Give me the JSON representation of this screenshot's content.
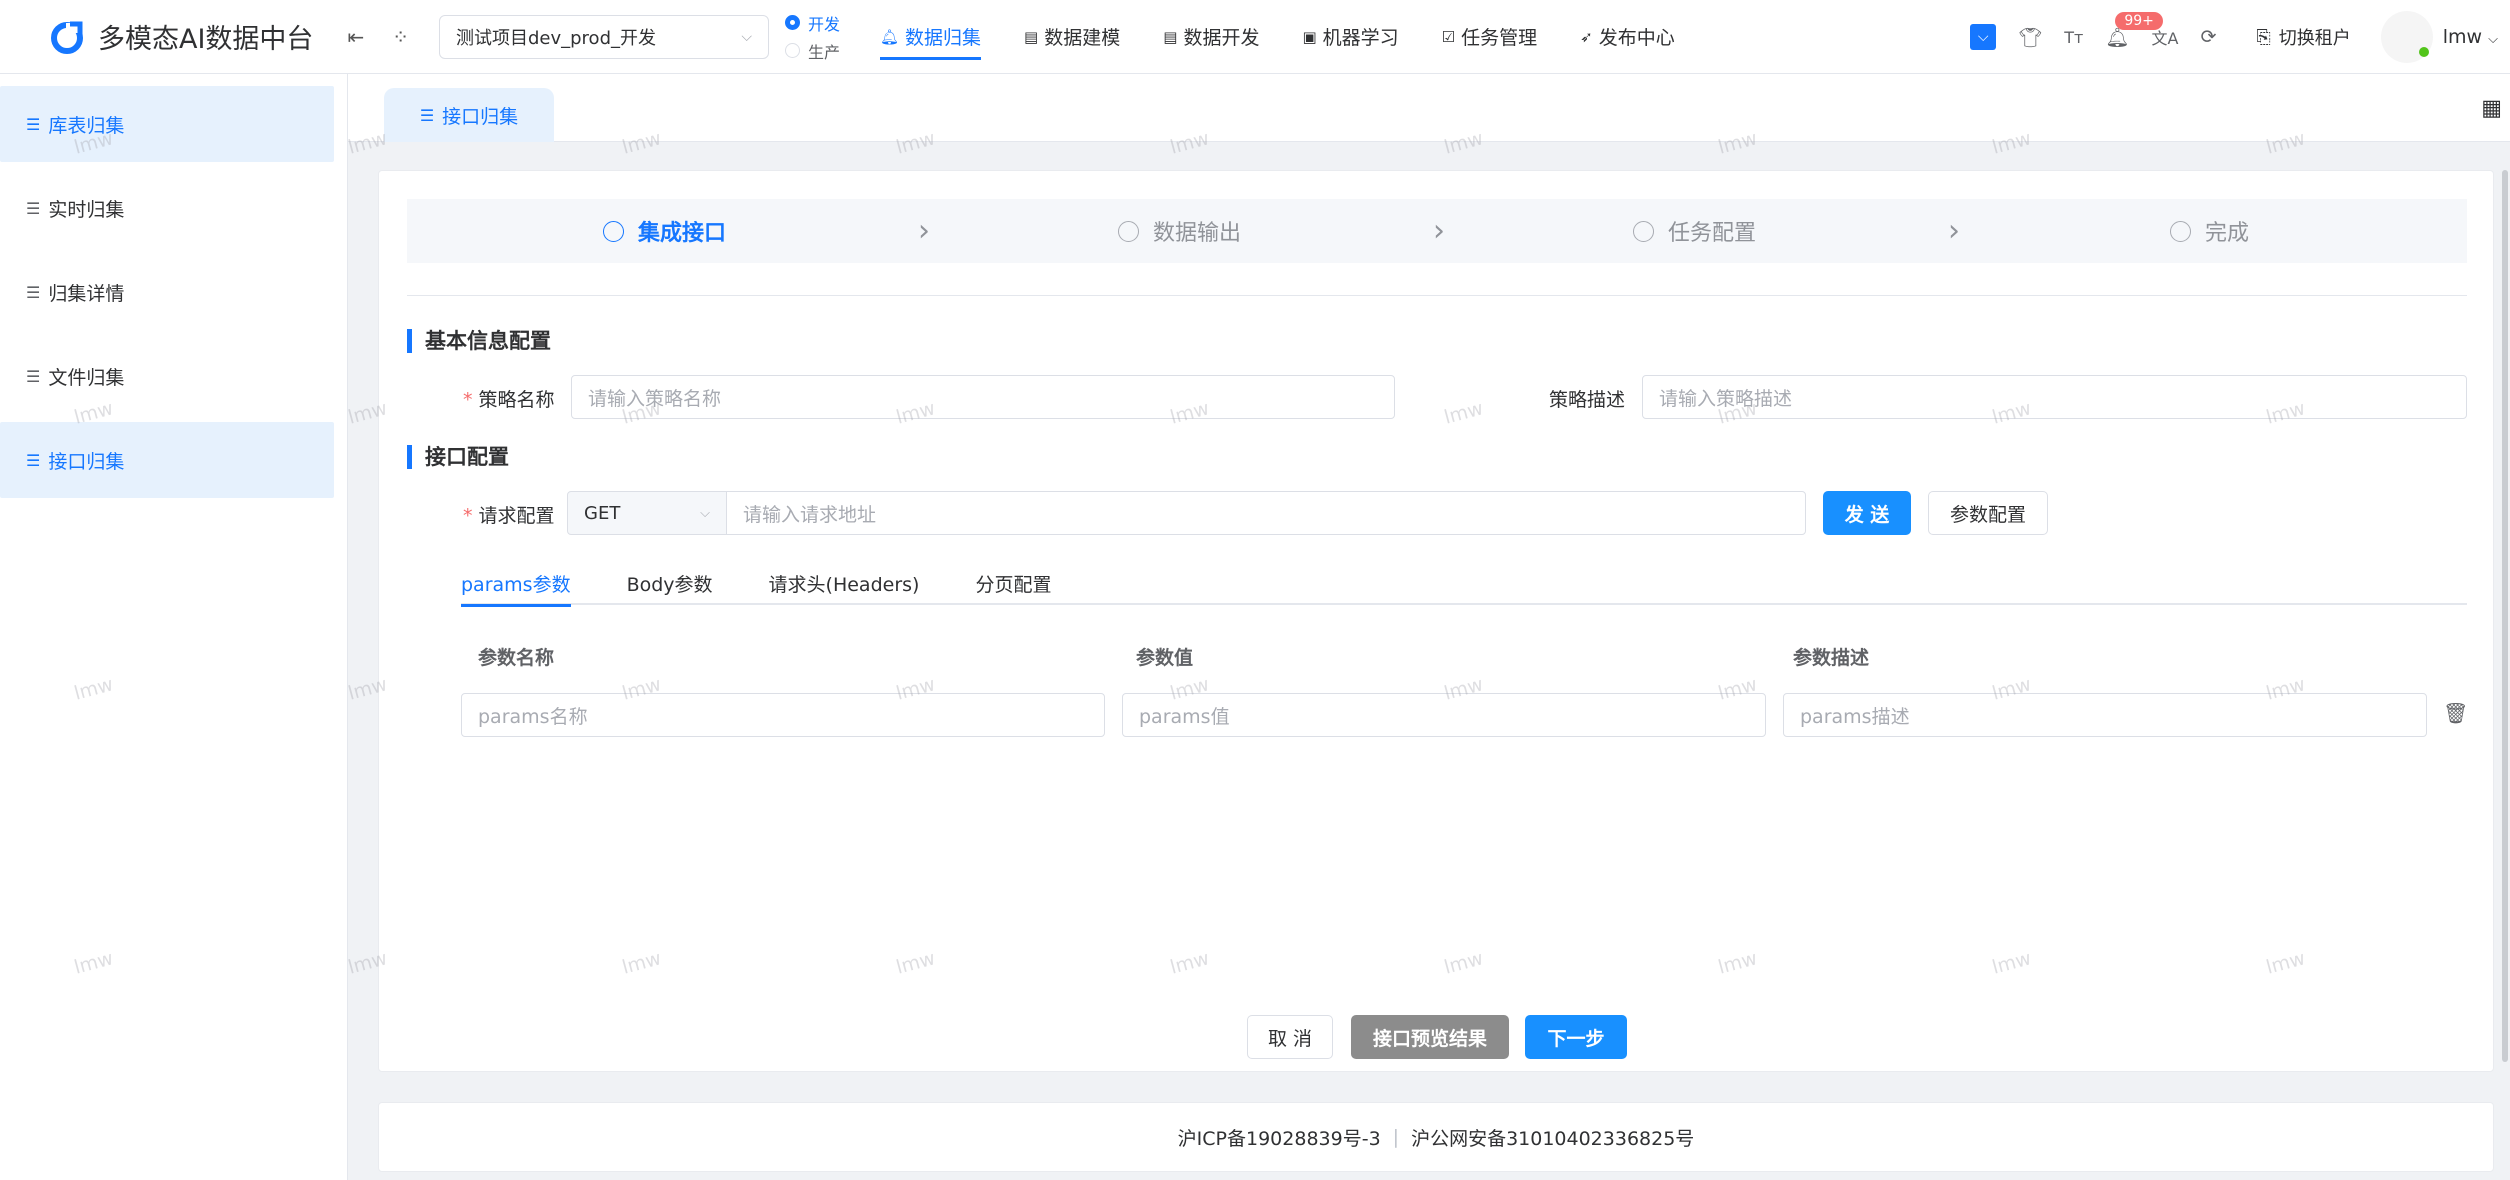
{
  "app": {
    "title": "多模态AI数据中台",
    "brand_color": "#1677ff"
  },
  "header": {
    "project_select": "测试项目dev_prod_开发",
    "env_options": [
      {
        "label": "开发",
        "selected": true
      },
      {
        "label": "生产",
        "selected": false
      }
    ],
    "nav": [
      {
        "label": "数据归集",
        "icon": "bell-icon",
        "active": true
      },
      {
        "label": "数据建模",
        "icon": "box-icon",
        "active": false
      },
      {
        "label": "数据开发",
        "icon": "box-icon",
        "active": false
      },
      {
        "label": "机器学习",
        "icon": "robot-icon",
        "active": false
      },
      {
        "label": "任务管理",
        "icon": "check-square-icon",
        "active": false
      },
      {
        "label": "发布中心",
        "icon": "send-icon",
        "active": false
      }
    ],
    "notification_badge": "99+",
    "switch_tenant": "切换租户",
    "user": "lmw"
  },
  "sidebar": {
    "items": [
      {
        "label": "库表归集",
        "active": true
      },
      {
        "label": "实时归集",
        "active": false
      },
      {
        "label": "归集详情",
        "active": false
      },
      {
        "label": "文件归集",
        "active": false
      },
      {
        "label": "接口归集",
        "active": true
      }
    ]
  },
  "page_tab": "接口归集",
  "steps": [
    {
      "label": "集成接口",
      "active": true
    },
    {
      "label": "数据输出",
      "active": false
    },
    {
      "label": "任务配置",
      "active": false
    },
    {
      "label": "完成",
      "active": false
    }
  ],
  "basic": {
    "section_title": "基本信息配置",
    "name_label": "策略名称",
    "name_placeholder": "请输入策略名称",
    "desc_label": "策略描述",
    "desc_placeholder": "请输入策略描述"
  },
  "api": {
    "section_title": "接口配置",
    "request_label": "请求配置",
    "method": "GET",
    "url_placeholder": "请输入请求地址",
    "send_button": "发 送",
    "params_button": "参数配置"
  },
  "tabs": [
    {
      "label": "params参数",
      "active": true
    },
    {
      "label": "Body参数",
      "active": false
    },
    {
      "label": "请求头(Headers)",
      "active": false
    },
    {
      "label": "分页配置",
      "active": false
    }
  ],
  "params_table": {
    "columns": [
      "参数名称",
      "参数值",
      "参数描述"
    ],
    "placeholders": [
      "params名称",
      "params值",
      "params描述"
    ]
  },
  "actions": {
    "cancel": "取 消",
    "preview": "接口预览结果",
    "next": "下一步"
  },
  "footer": {
    "icp": "沪ICP备19028839号-3",
    "police": "沪公网安备31010402336825号"
  },
  "watermark": "lmw"
}
